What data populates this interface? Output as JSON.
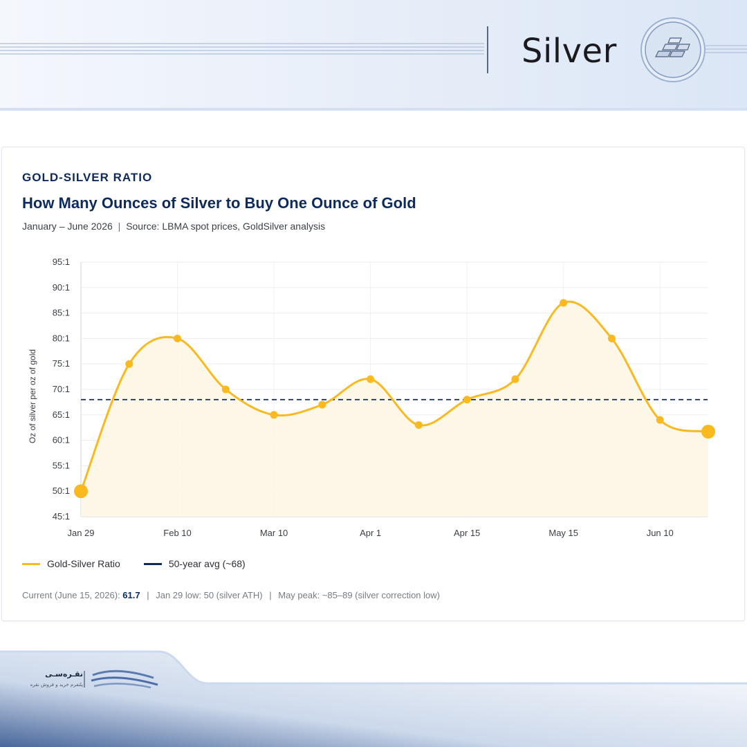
{
  "header": {
    "title": "Silver",
    "badge_icon": "silver-bars-icon"
  },
  "card": {
    "eyebrow": "GOLD-SILVER RATIO",
    "title": "How Many Ounces of Silver to Buy One Ounce of Gold",
    "subtitle_period": "January – June 2026",
    "subtitle_separator": "|",
    "subtitle_source": "Source: LBMA spot prices, GoldSilver analysis"
  },
  "legend": {
    "series_label": "Gold-Silver Ratio",
    "avg_label": "50-year avg (~68)"
  },
  "footnote": {
    "current_label": "Current (June 15, 2026):",
    "current_value": "61.7",
    "separator": "|",
    "low_text": "Jan 29 low: 50 (silver ATH)",
    "peak_text": "May peak: ~85–89 (silver correction low)"
  },
  "footer": {
    "brand_name": "نقـره‌سـی",
    "brand_tagline": "پلتفرم خرید و فروش نقره",
    "logo_icon": "wave-logo-icon"
  },
  "colors": {
    "accent_gold": "#f9b91f",
    "navy": "#0d2a5c",
    "area_fill": "#fdf6e4"
  },
  "chart_data": {
    "type": "line",
    "title": "How Many Ounces of Silver to Buy One Ounce of Gold",
    "ylabel": "Oz of silver per oz of gold",
    "xlabel": "",
    "ylim": [
      45,
      95
    ],
    "y_ticks": [
      45,
      50,
      55,
      60,
      65,
      70,
      75,
      80,
      85,
      90,
      95
    ],
    "y_tick_labels": [
      "45:1",
      "50:1",
      "55:1",
      "60:1",
      "65:1",
      "70:1",
      "75:1",
      "80:1",
      "85:1",
      "90:1",
      "95:1"
    ],
    "x_tick_labels": [
      "Jan 29",
      "Feb 10",
      "Mar 10",
      "Apr 1",
      "Apr 15",
      "May 15",
      "Jun 10"
    ],
    "grid": true,
    "legend_position": "bottom-left",
    "series": [
      {
        "name": "Gold-Silver Ratio",
        "color": "#f9b91f",
        "values": [
          50,
          75,
          80,
          70,
          65,
          67,
          72,
          63,
          68,
          72,
          87,
          80,
          64,
          61.7
        ]
      }
    ],
    "reference_lines": [
      {
        "name": "50-year avg (~68)",
        "value": 68,
        "style": "dashed",
        "color": "#0d2a5c"
      }
    ],
    "highlighted_points": [
      0,
      13
    ]
  }
}
